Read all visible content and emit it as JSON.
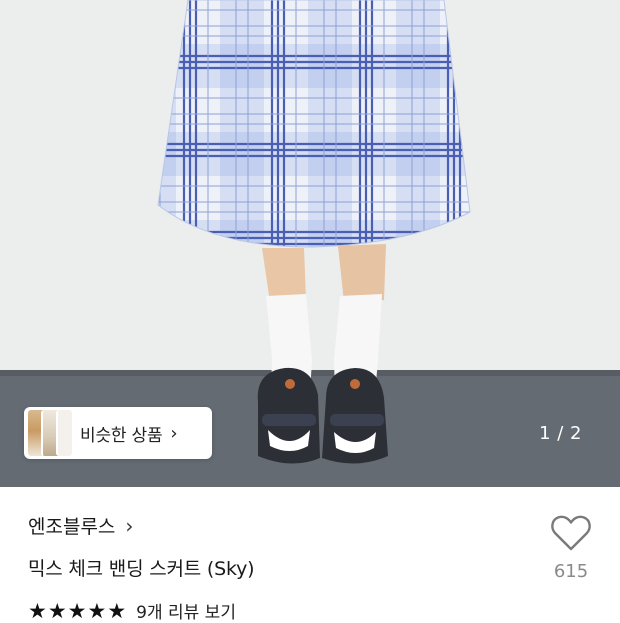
{
  "photo": {
    "page_indicator": "1 / 2"
  },
  "similar_products": {
    "label": "비슷한 상품",
    "chevron": "chevron-right-icon"
  },
  "product": {
    "brand": "엔조블루스",
    "brand_chevron": "chevron-right-icon",
    "name": "믹스 체크 밴딩 스커트 (Sky)",
    "rating": 5,
    "rating_max": 5,
    "review_link": "9개 리뷰 보기"
  },
  "like": {
    "icon": "heart-outline-icon",
    "count": "615"
  },
  "colors": {
    "skirt_base": "#cdd8ef",
    "check_line": "#4a5fb3",
    "wall": "#eceded",
    "floor": "#656b73"
  }
}
